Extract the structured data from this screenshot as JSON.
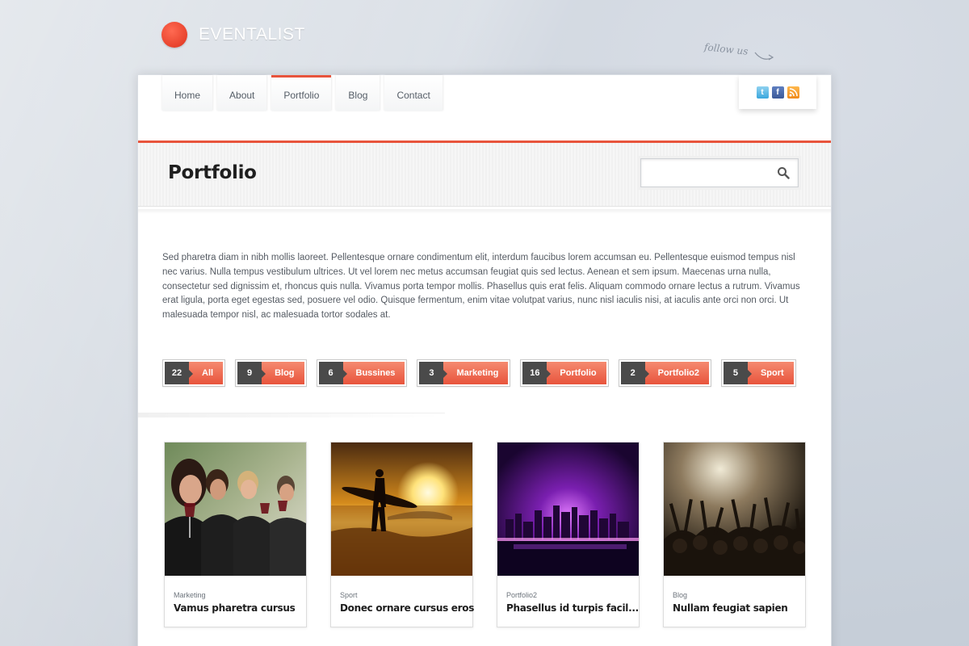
{
  "brand": {
    "name": "EVENTALIST",
    "accent": "#e8543c"
  },
  "follow_us": "follow us",
  "nav": [
    {
      "label": "Home",
      "active": false
    },
    {
      "label": "About",
      "active": false
    },
    {
      "label": "Portfolio",
      "active": true
    },
    {
      "label": "Blog",
      "active": false
    },
    {
      "label": "Contact",
      "active": false
    }
  ],
  "social": [
    {
      "icon": "twitter-icon"
    },
    {
      "icon": "facebook-icon"
    },
    {
      "icon": "rss-icon"
    }
  ],
  "page": {
    "title": "Portfolio",
    "search_placeholder": "",
    "intro": "Sed pharetra diam in nibh mollis laoreet. Pellentesque ornare condimentum elit, interdum faucibus lorem accumsan eu. Pellentesque euismod tempus nisl nec varius. Nulla tempus vestibulum ultrices. Ut vel lorem nec metus accumsan feugiat quis sed lectus. Aenean et sem ipsum. Maecenas urna nulla, consectetur sed dignissim et, rhoncus quis nulla. Vivamus porta tempor mollis. Phasellus quis erat felis. Aliquam commodo ornare lectus a rutrum. Vivamus erat ligula, porta eget egestas sed, posuere vel odio. Quisque fermentum, enim vitae volutpat varius, nunc nisl iaculis nisi, at iaculis ante orci non orci. Ut malesuada tempor nisl, ac malesuada tortor sodales at."
  },
  "filters": [
    {
      "count": "22",
      "label": "All"
    },
    {
      "count": "9",
      "label": "Blog"
    },
    {
      "count": "6",
      "label": "Bussines"
    },
    {
      "count": "3",
      "label": "Marketing"
    },
    {
      "count": "16",
      "label": "Portfolio"
    },
    {
      "count": "2",
      "label": "Portfolio2"
    },
    {
      "count": "5",
      "label": "Sport"
    }
  ],
  "portfolio_items": [
    {
      "category": "Marketing",
      "title": "Vamus pharetra cursus"
    },
    {
      "category": "Sport",
      "title": "Donec ornare cursus eros"
    },
    {
      "category": "Portfolio2",
      "title": "Phasellus id turpis facil..."
    },
    {
      "category": "Blog",
      "title": "Nullam feugiat sapien"
    }
  ]
}
